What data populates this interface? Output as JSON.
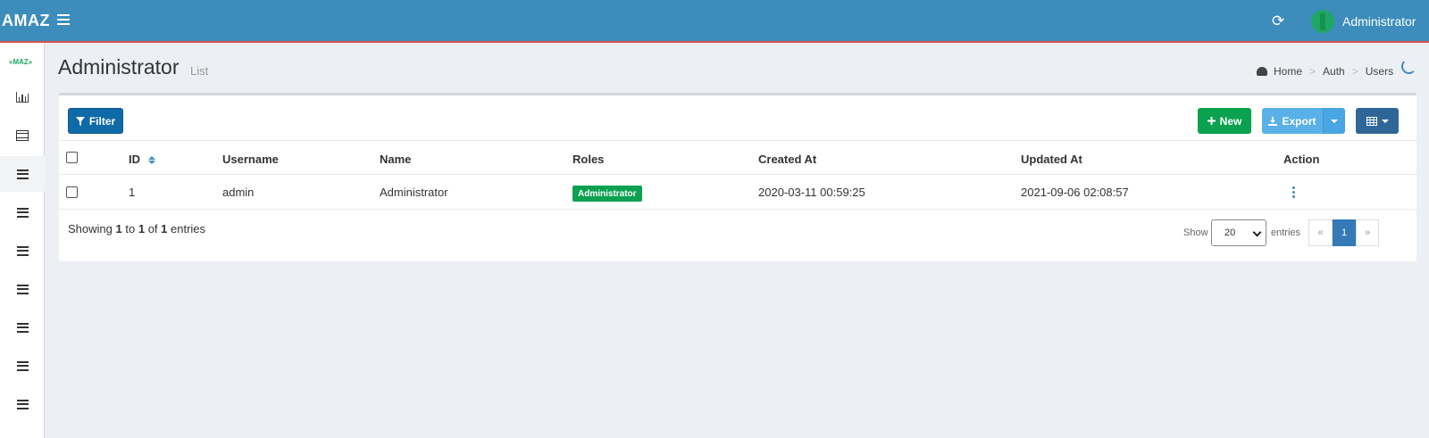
{
  "header": {
    "logo": "AMAZ",
    "user_name": "Administrator",
    "refresh_glyph": "⟳"
  },
  "sidebar": {
    "logo": "«MAZ»",
    "items": [
      {
        "icon": "bar-chart-icon"
      },
      {
        "icon": "table-icon"
      },
      {
        "icon": "bars-icon",
        "active": true
      },
      {
        "icon": "bars-icon"
      },
      {
        "icon": "bars-icon"
      },
      {
        "icon": "bars-icon"
      },
      {
        "icon": "bars-icon"
      },
      {
        "icon": "bars-icon"
      },
      {
        "icon": "bars-icon"
      }
    ]
  },
  "page": {
    "title": "Administrator",
    "subtitle": "List",
    "breadcrumb": [
      "Home",
      "Auth",
      "Users"
    ]
  },
  "toolbar": {
    "filter_label": "Filter",
    "new_label": "New",
    "export_label": "Export"
  },
  "table": {
    "columns": [
      "ID",
      "Username",
      "Name",
      "Roles",
      "Created At",
      "Updated At",
      "Action"
    ],
    "rows": [
      {
        "id": "1",
        "username": "admin",
        "name": "Administrator",
        "role": "Administrator",
        "created_at": "2020-03-11 00:59:25",
        "updated_at": "2021-09-06 02:08:57"
      }
    ]
  },
  "footer": {
    "showing_prefix": "Showing",
    "from": "1",
    "to_word": "to",
    "to": "1",
    "of_word": "of",
    "total": "1",
    "entries_word": "entries",
    "show_label": "Show",
    "per_page": "20",
    "entries_label": "entries",
    "pages": [
      "«",
      "1",
      "»"
    ]
  },
  "colors": {
    "header": "#3c8dbc",
    "success": "#0aa150",
    "primary": "#0f6ba8"
  }
}
